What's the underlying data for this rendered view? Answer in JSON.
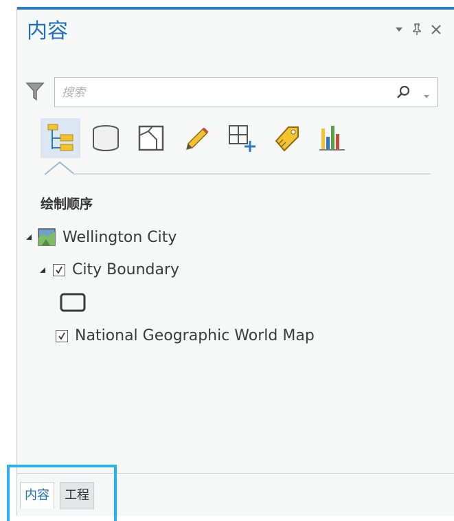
{
  "pane": {
    "title": "内容",
    "search_placeholder": "搜索"
  },
  "section": {
    "title": "绘制顺序"
  },
  "tree": {
    "map": {
      "label": "Wellington City"
    },
    "layers": [
      {
        "label": "City Boundary",
        "checked": true
      },
      {
        "label": "National Geographic World Map",
        "checked": true
      }
    ]
  },
  "bottom_tabs": [
    {
      "label": "内容",
      "active": true
    },
    {
      "label": "工程",
      "active": false
    }
  ],
  "colors": {
    "accent": "#1f6fc0",
    "highlight": "#2bb2e6"
  }
}
